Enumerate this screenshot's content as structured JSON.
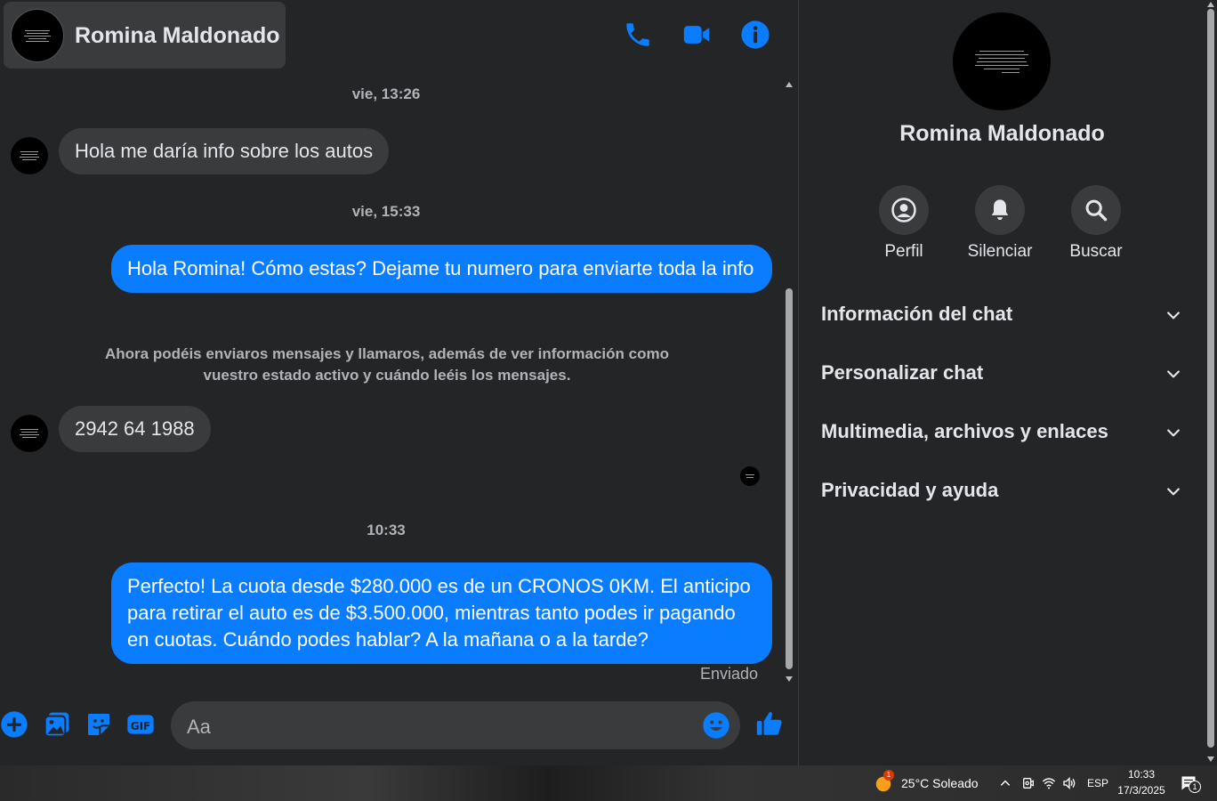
{
  "header": {
    "contact_name": "Romina Maldonado",
    "icons": [
      "phone-icon",
      "video-call-icon",
      "info-icon"
    ]
  },
  "messages": {
    "ts1": "vie, 13:26",
    "msg1": "Hola me daría info sobre los autos",
    "ts2": "vie, 15:33",
    "msg2": "Hola Romina! Cómo estas? Dejame tu numero para enviarte toda la info",
    "system_note": "Ahora podéis enviaros mensajes y llamaros, además de ver información como vuestro estado activo y cuándo leéis los mensajes.",
    "msg3": "2942 64 1988",
    "ts3": "10:33",
    "msg4": "Perfecto! La cuota desde $280.000 es de un CRONOS 0KM. El anticipo para retirar el auto es de $3.500.000, mientras tanto podes ir pagando en cuotas. Cuándo podes hablar? A la mañana o a la tarde?",
    "status": "Enviado"
  },
  "composer": {
    "placeholder": "Aa",
    "icons": [
      "plus-icon",
      "image-icon",
      "sticker-icon",
      "gif-icon",
      "emoji-icon",
      "like-icon"
    ]
  },
  "panel": {
    "name": "Romina Maldonado",
    "actions": [
      {
        "label": "Perfil",
        "icon": "profile-icon"
      },
      {
        "label": "Silenciar",
        "icon": "bell-icon"
      },
      {
        "label": "Buscar",
        "icon": "search-icon"
      }
    ],
    "sections": [
      "Información del chat",
      "Personalizar chat",
      "Multimedia, archivos y enlaces",
      "Privacidad y ayuda"
    ]
  },
  "taskbar": {
    "weather": "25°C  Soleado",
    "weather_badge": "1",
    "language": "ESP",
    "time": "10:33",
    "date": "17/3/2025",
    "notif_count": "1"
  },
  "colors": {
    "accent": "#0a7cff",
    "background": "#242526",
    "bubble_in": "#3a3b3c"
  }
}
